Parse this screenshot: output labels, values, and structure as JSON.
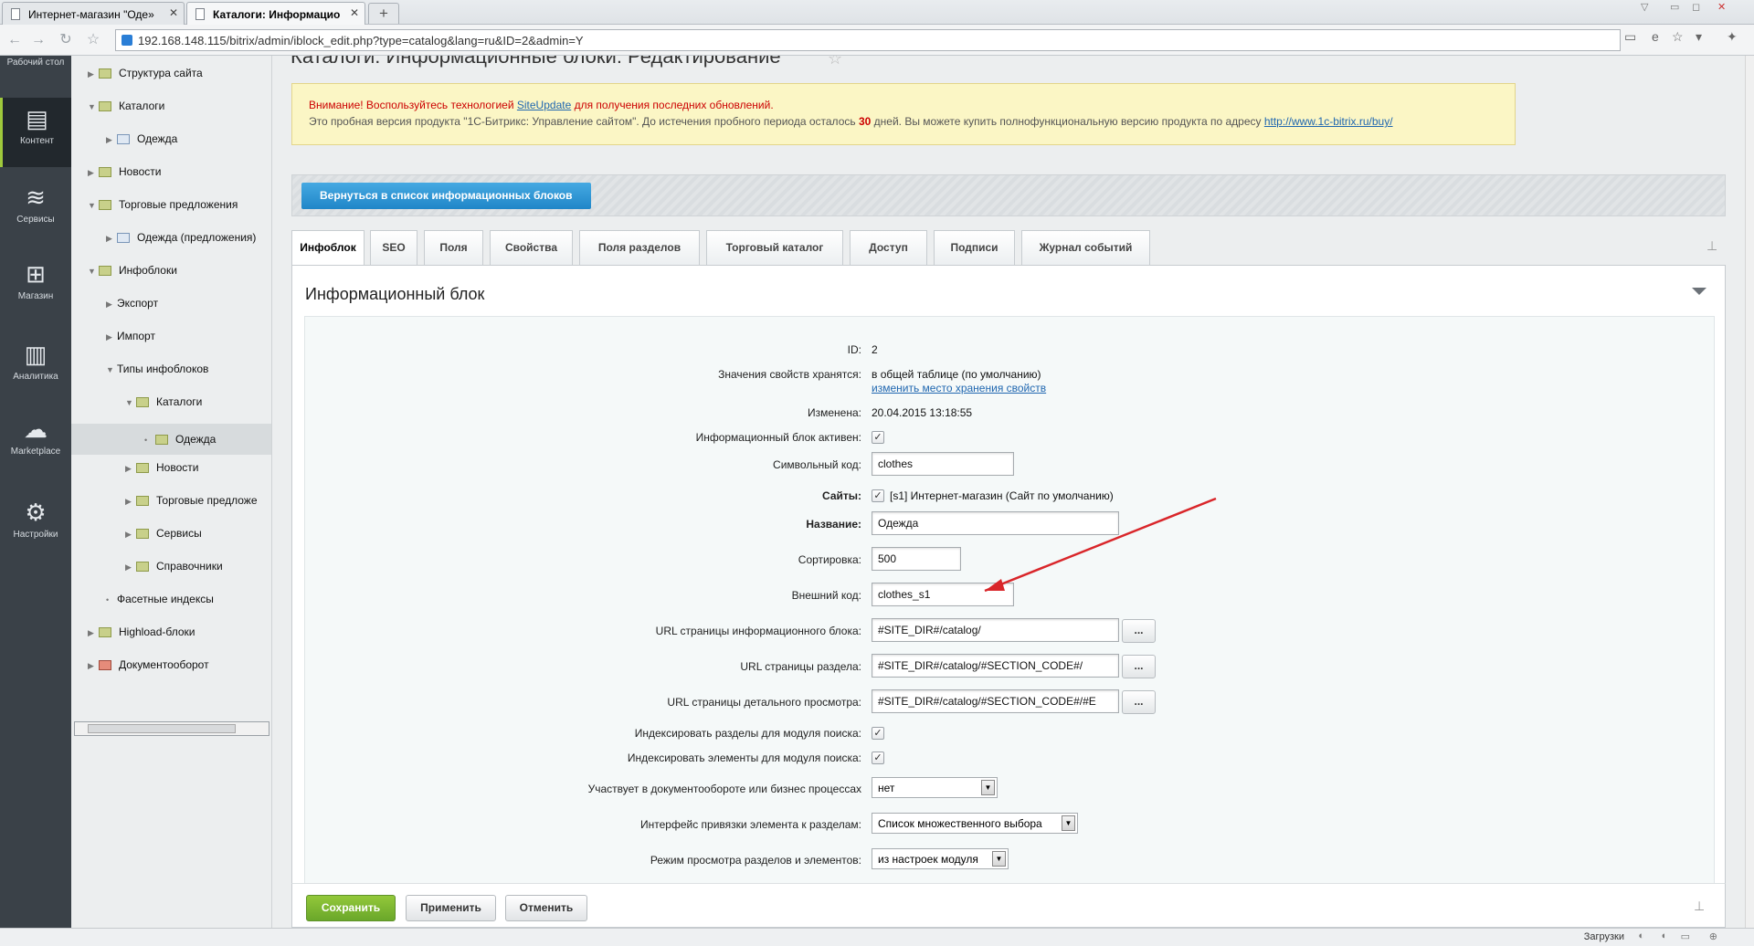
{
  "browser": {
    "tabs": [
      {
        "label": "Интернет-магазин \"Оде»",
        "active": false
      },
      {
        "label": "Каталоги: Информацио",
        "active": true
      }
    ],
    "new_tab": "+",
    "url": "192.168.148.115/bitrix/admin/iblock_edit.php?type=catalog&lang=ru&ID=2&admin=Y"
  },
  "leftbar": {
    "items": [
      {
        "label": "Рабочий стол",
        "icon": "desktop-icon"
      },
      {
        "label": "Контент",
        "icon": "content-icon",
        "active": true
      },
      {
        "label": "Сервисы",
        "icon": "services-icon"
      },
      {
        "label": "Магазин",
        "icon": "shop-basket-icon"
      },
      {
        "label": "Аналитика",
        "icon": "analytics-icon"
      },
      {
        "label": "Marketplace",
        "icon": "marketplace-cloud-icon"
      },
      {
        "label": "Настройки",
        "icon": "gear-icon"
      }
    ]
  },
  "tree": {
    "items": [
      {
        "label": "Структура сайта",
        "arrow": "▶"
      },
      {
        "label": "Каталоги",
        "arrow": "▼"
      },
      {
        "label": "Одежда",
        "arrow": "▶"
      },
      {
        "label": "Новости",
        "arrow": "▶"
      },
      {
        "label": "Торговые предложения",
        "arrow": "▼"
      },
      {
        "label": "Одежда (предложения)",
        "arrow": "▶"
      },
      {
        "label": "Инфоблоки",
        "arrow": "▼"
      },
      {
        "label": "Экспорт",
        "arrow": "▶"
      },
      {
        "label": "Импорт",
        "arrow": "▶"
      },
      {
        "label": "Типы инфоблоков",
        "arrow": "▼"
      },
      {
        "label": "Каталоги",
        "arrow": "▼"
      },
      {
        "label": "Одежда",
        "arrow": "•"
      },
      {
        "label": "Новости",
        "arrow": "▶"
      },
      {
        "label": "Торговые предложе",
        "arrow": "▶"
      },
      {
        "label": "Сервисы",
        "arrow": "▶"
      },
      {
        "label": "Справочники",
        "arrow": "▶"
      },
      {
        "label": "Фасетные индексы",
        "arrow": "•"
      },
      {
        "label": "Highload-блоки",
        "arrow": "▶"
      },
      {
        "label": "Документооборот",
        "arrow": "▶"
      }
    ]
  },
  "page": {
    "title": "Каталоги: Информационные блоки: Редактирование",
    "notice": {
      "line1_warn": "Внимание! Воспользуйтесь технологией ",
      "line1_link": "SiteUpdate",
      "line1_rest": " для получения последних обновлений.",
      "line2_a": "Это пробная версия продукта \"1С-Битрикс: Управление сайтом\". До истечения пробного периода осталось ",
      "line2_days": "30",
      "line2_b": " дней. Вы можете купить полнофункциональную версию продукта по адресу ",
      "line2_link": "http://www.1c-bitrix.ru/buy/"
    },
    "back_button": "Вернуться в список информационных блоков",
    "tabs": [
      "Инфоблок",
      "SEO",
      "Поля",
      "Свойства",
      "Поля разделов",
      "Торговый каталог",
      "Доступ",
      "Подписи",
      "Журнал событий"
    ],
    "section_title": "Информационный блок"
  },
  "form": {
    "id_label": "ID:",
    "id_value": "2",
    "storage_label": "Значения свойств хранятся:",
    "storage_value": "в общей таблице (по умолчанию)",
    "storage_link": "изменить место хранения свойств",
    "changed_label": "Изменена:",
    "changed_value": "20.04.2015 13:18:55",
    "active_label": "Информационный блок активен:",
    "active_checked": true,
    "code_label": "Символьный код:",
    "code_value": "clothes",
    "sites_label": "Сайты:",
    "sites_value": "[s1] Интернет-магазин (Сайт по умолчанию)",
    "name_label": "Название:",
    "name_value": "Одежда",
    "sort_label": "Сортировка:",
    "sort_value": "500",
    "xml_label": "Внешний код:",
    "xml_value": "clothes_s1",
    "url_iblock_label": "URL страницы информационного блока:",
    "url_iblock_value": "#SITE_DIR#/catalog/",
    "url_section_label": "URL страницы раздела:",
    "url_section_value": "#SITE_DIR#/catalog/#SECTION_CODE#/",
    "url_detail_label": "URL страницы детального просмотра:",
    "url_detail_value": "#SITE_DIR#/catalog/#SECTION_CODE#/#E",
    "dots": "...",
    "index_sections_label": "Индексировать разделы для модуля поиска:",
    "index_elements_label": "Индексировать элементы для модуля поиска:",
    "workflow_label": "Участвует в документообороте или бизнес процессах",
    "workflow_value": "нет",
    "section_iface_label": "Интерфейс привязки элемента к разделам:",
    "section_iface_value": "Список множественного выбора",
    "view_mode_label": "Режим просмотра разделов и элементов:",
    "view_mode_value": "из настроек модуля"
  },
  "footer": {
    "save": "Сохранить",
    "apply": "Применить",
    "cancel": "Отменить"
  },
  "status": {
    "downloads": "Загрузки"
  },
  "colors": {
    "annotation_arrow": "#d9262a",
    "accent_blue": "#1f86c8",
    "save_green": "#7ab532"
  }
}
